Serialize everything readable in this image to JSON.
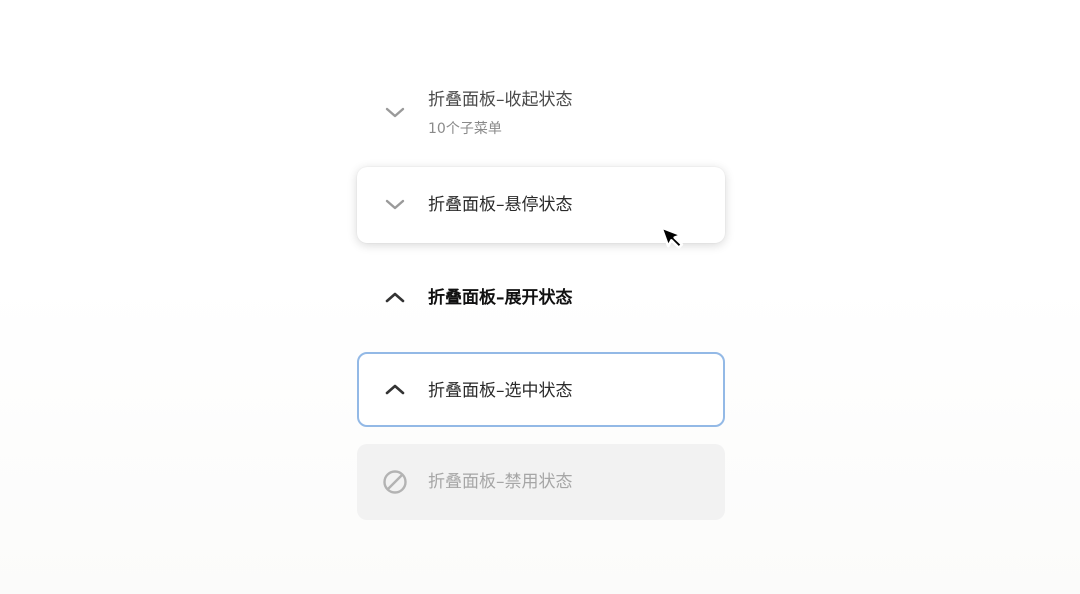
{
  "panels": {
    "collapsed": {
      "title": "折叠面板–收起状态",
      "subtitle": "10个子菜单",
      "icon": "chevron-down-icon"
    },
    "hover": {
      "title": "折叠面板–悬停状态",
      "icon": "chevron-down-icon"
    },
    "expanded": {
      "title": "折叠面板–展开状态",
      "icon": "chevron-up-icon"
    },
    "selected": {
      "title": "折叠面板–选中状态",
      "icon": "chevron-up-icon",
      "border_color": "#93b9e6"
    },
    "disabled": {
      "title": "折叠面板–禁用状态",
      "icon": "disabled-icon",
      "background_color": "#f2f2f2"
    }
  },
  "cursor": {
    "icon": "mouse-pointer-icon"
  }
}
